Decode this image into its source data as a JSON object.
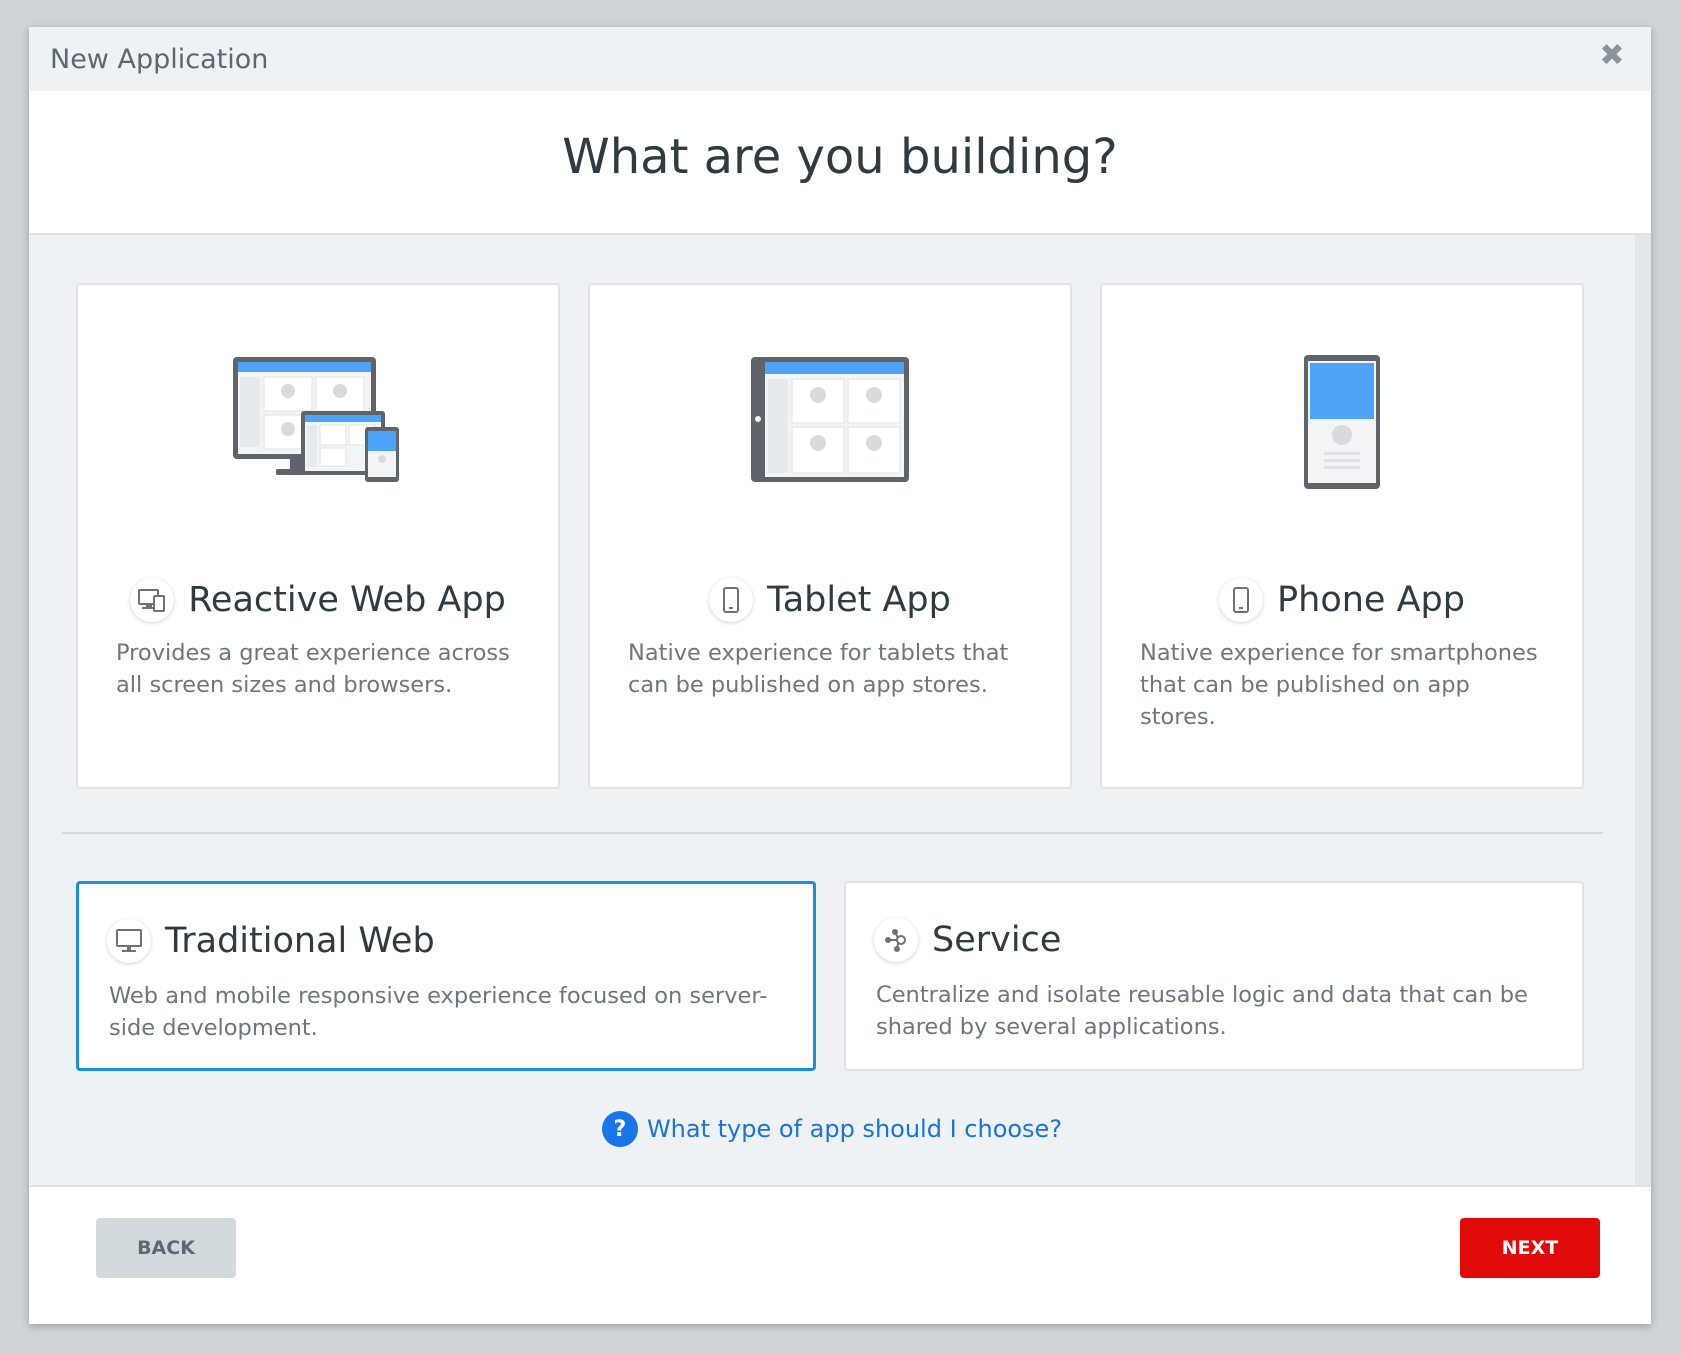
{
  "dialog": {
    "title": "New Application",
    "heading": "What are you building?"
  },
  "app_types": [
    {
      "name": "Reactive Web App",
      "description": "Provides a great experience across all screen sizes and browsers.",
      "icon": "devices-icon"
    },
    {
      "name": "Tablet App",
      "description": "Native experience for tablets that can be published on app stores.",
      "icon": "tablet-icon"
    },
    {
      "name": "Phone App",
      "description": "Native experience for smartphones that can be published on app stores.",
      "icon": "phone-icon"
    }
  ],
  "other_types": [
    {
      "name": "Traditional Web",
      "description": "Web and mobile responsive experience focused on server-side development.",
      "icon": "monitor-icon",
      "selected": true
    },
    {
      "name": "Service",
      "description": "Centralize and isolate reusable logic and data that can be shared by several applications.",
      "icon": "service-nodes-icon",
      "selected": false
    }
  ],
  "help_link": "What type of app should I choose?",
  "buttons": {
    "back": "BACK",
    "next": "NEXT"
  },
  "colors": {
    "accent_blue": "#1a8fe0",
    "illustration_blue": "#4da3f5",
    "next_red": "#e00a0a",
    "link_blue": "#1a73d6"
  }
}
